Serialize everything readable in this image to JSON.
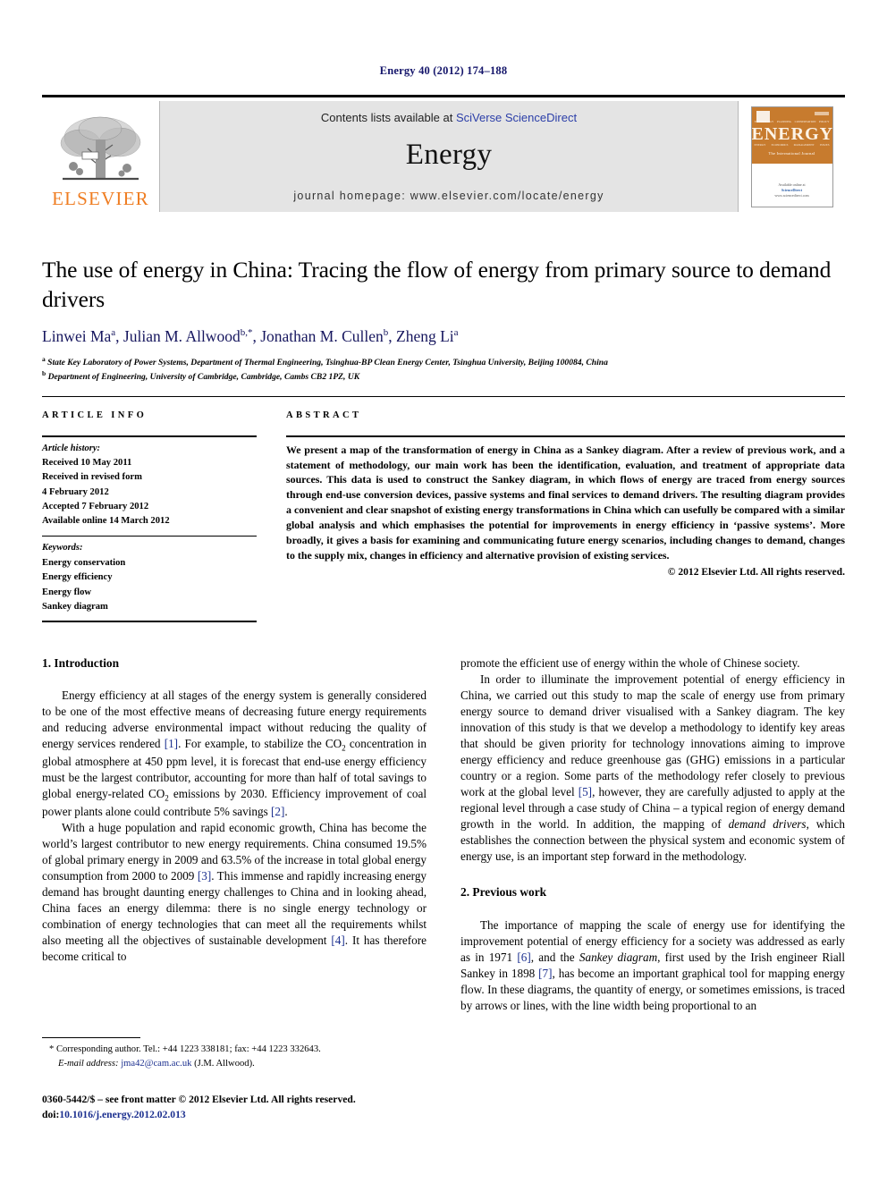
{
  "running_head": "Energy 40 (2012) 174–188",
  "masthead": {
    "publisher_name": "ELSEVIER",
    "contents_prefix": "Contents lists available at ",
    "contents_link": "SciVerse ScienceDirect",
    "journal_title": "Energy",
    "homepage": "journal homepage: www.elsevier.com/locate/energy",
    "cover": {
      "title": "ENERGY",
      "subtitle": "The International Journal",
      "top_labels": [
        "TECHNOLOGY",
        "PLANNING",
        "CONSERVATION",
        "POLICY"
      ],
      "bottom_labels": [
        "ENERGY",
        "ECONOMICS",
        "MANAGEMENT",
        "ISSUES"
      ],
      "footer_note": "Available online at",
      "footer_brand": "ScienceDirect",
      "footer_url": "www.sciencedirect.com"
    }
  },
  "article": {
    "title": "The use of energy in China: Tracing the flow of energy from primary source to demand drivers",
    "authors_html": "Linwei Ma<sup>a</sup>, Julian M. Allwood<sup>b,*</sup>, Jonathan M. Cullen<sup>b</sup>, Zheng Li<sup>a</sup>",
    "affiliation_a": "State Key Laboratory of Power Systems, Department of Thermal Engineering, Tsinghua-BP Clean Energy Center, Tsinghua University, Beijing 100084, China",
    "affiliation_b": "Department of Engineering, University of Cambridge, Cambridge, Cambs CB2 1PZ, UK"
  },
  "headings": {
    "article_info": "ARTICLE INFO",
    "abstract": "ABSTRACT"
  },
  "article_info": {
    "history_label": "Article history:",
    "history": [
      "Received 10 May 2011",
      "Received in revised form",
      "4 February 2012",
      "Accepted 7 February 2012",
      "Available online 14 March 2012"
    ],
    "keywords_label": "Keywords:",
    "keywords": [
      "Energy conservation",
      "Energy efficiency",
      "Energy flow",
      "Sankey diagram"
    ]
  },
  "abstract": {
    "text": "We present a map of the transformation of energy in China as a Sankey diagram. After a review of previous work, and a statement of methodology, our main work has been the identification, evaluation, and treatment of appropriate data sources. This data is used to construct the Sankey diagram, in which flows of energy are traced from energy sources through end-use conversion devices, passive systems and final services to demand drivers. The resulting diagram provides a convenient and clear snapshot of existing energy transformations in China which can usefully be compared with a similar global analysis and which emphasises the potential for improvements in energy efficiency in ‘passive systems’. More broadly, it gives a basis for examining and communicating future energy scenarios, including changes to demand, changes to the supply mix, changes in efficiency and alternative provision of existing services.",
    "copyright": "© 2012 Elsevier Ltd. All rights reserved."
  },
  "body": {
    "section1_heading": "1. Introduction",
    "section2_heading": "2. Previous work",
    "left_p1_html": "Energy efficiency at all stages of the energy system is generally considered to be one of the most effective means of decreasing future energy requirements and reducing adverse environmental impact without reducing the quality of energy services rendered <span class=\"ref\">[1]</span>. For example, to stabilize the CO<sub>2</sub> concentration in global atmosphere at 450 ppm level, it is forecast that end-use energy efficiency must be the largest contributor, accounting for more than half of total savings to global energy-related CO<sub>2</sub> emissions by 2030. Efficiency improvement of coal power plants alone could contribute 5% savings <span class=\"ref\">[2]</span>.",
    "left_p2_html": "With a huge population and rapid economic growth, China has become the world’s largest contributor to new energy requirements. China consumed 19.5% of global primary energy in 2009 and 63.5% of the increase in total global energy consumption from 2000 to 2009 <span class=\"ref\">[3]</span>. This immense and rapidly increasing energy demand has brought daunting energy challenges to China and in looking ahead, China faces an energy dilemma: there is no single energy technology or combination of energy technologies that can meet all the requirements whilst also meeting all the objectives of sustainable development <span class=\"ref\">[4]</span>. It has therefore become critical to",
    "right_p1_html": "promote the efficient use of energy within the whole of Chinese society.",
    "right_p2_html": "In order to illuminate the improvement potential of energy efficiency in China, we carried out this study to map the scale of energy use from primary energy source to demand driver visualised with a Sankey diagram. The key innovation of this study is that we develop a methodology to identify key areas that should be given priority for technology innovations aiming to improve energy efficiency and reduce greenhouse gas (GHG) emissions in a particular country or a region. Some parts of the methodology refer closely to previous work at the global level <span class=\"ref\">[5]</span>, however, they are carefully adjusted to apply at the regional level through a case study of China – a typical region of energy demand growth in the world. In addition, the mapping of <span class=\"ital\">demand drivers</span>, which establishes the connection between the physical system and economic system of energy use, is an important step forward in the methodology.",
    "right_p3_html": "The importance of mapping the scale of energy use for identifying the improvement potential of energy efficiency for a society was addressed as early as in 1971 <span class=\"ref\">[6]</span>, and the <span class=\"ital\">Sankey diagram</span>, first used by the Irish engineer Riall Sankey in 1898 <span class=\"ref\">[7]</span>, has become an important graphical tool for mapping energy flow. In these diagrams, the quantity of energy, or sometimes emissions, is traced by arrows or lines, with the line width being proportional to an"
  },
  "footnotes": {
    "corresponding_html": "* Corresponding author. Tel.: +44 1223 338181; fax: +44 1223 332643.",
    "email_html": "<span class=\"ital\">E-mail address:</span> <span class=\"link\">jma42@cam.ac.uk</span> (J.M. Allwood)."
  },
  "imprint": {
    "line1": "0360-5442/$ – see front matter © 2012 Elsevier Ltd. All rights reserved.",
    "doi_prefix": "doi:",
    "doi": "10.1016/j.energy.2012.02.013"
  },
  "colors": {
    "running_head": "#15166b",
    "elsevier_orange": "#ef7d22",
    "link_blue": "#1b2f8f",
    "author_navy": "#16165e",
    "band_gray": "#e4e4e4",
    "cover_orange": "#c77b2e"
  }
}
